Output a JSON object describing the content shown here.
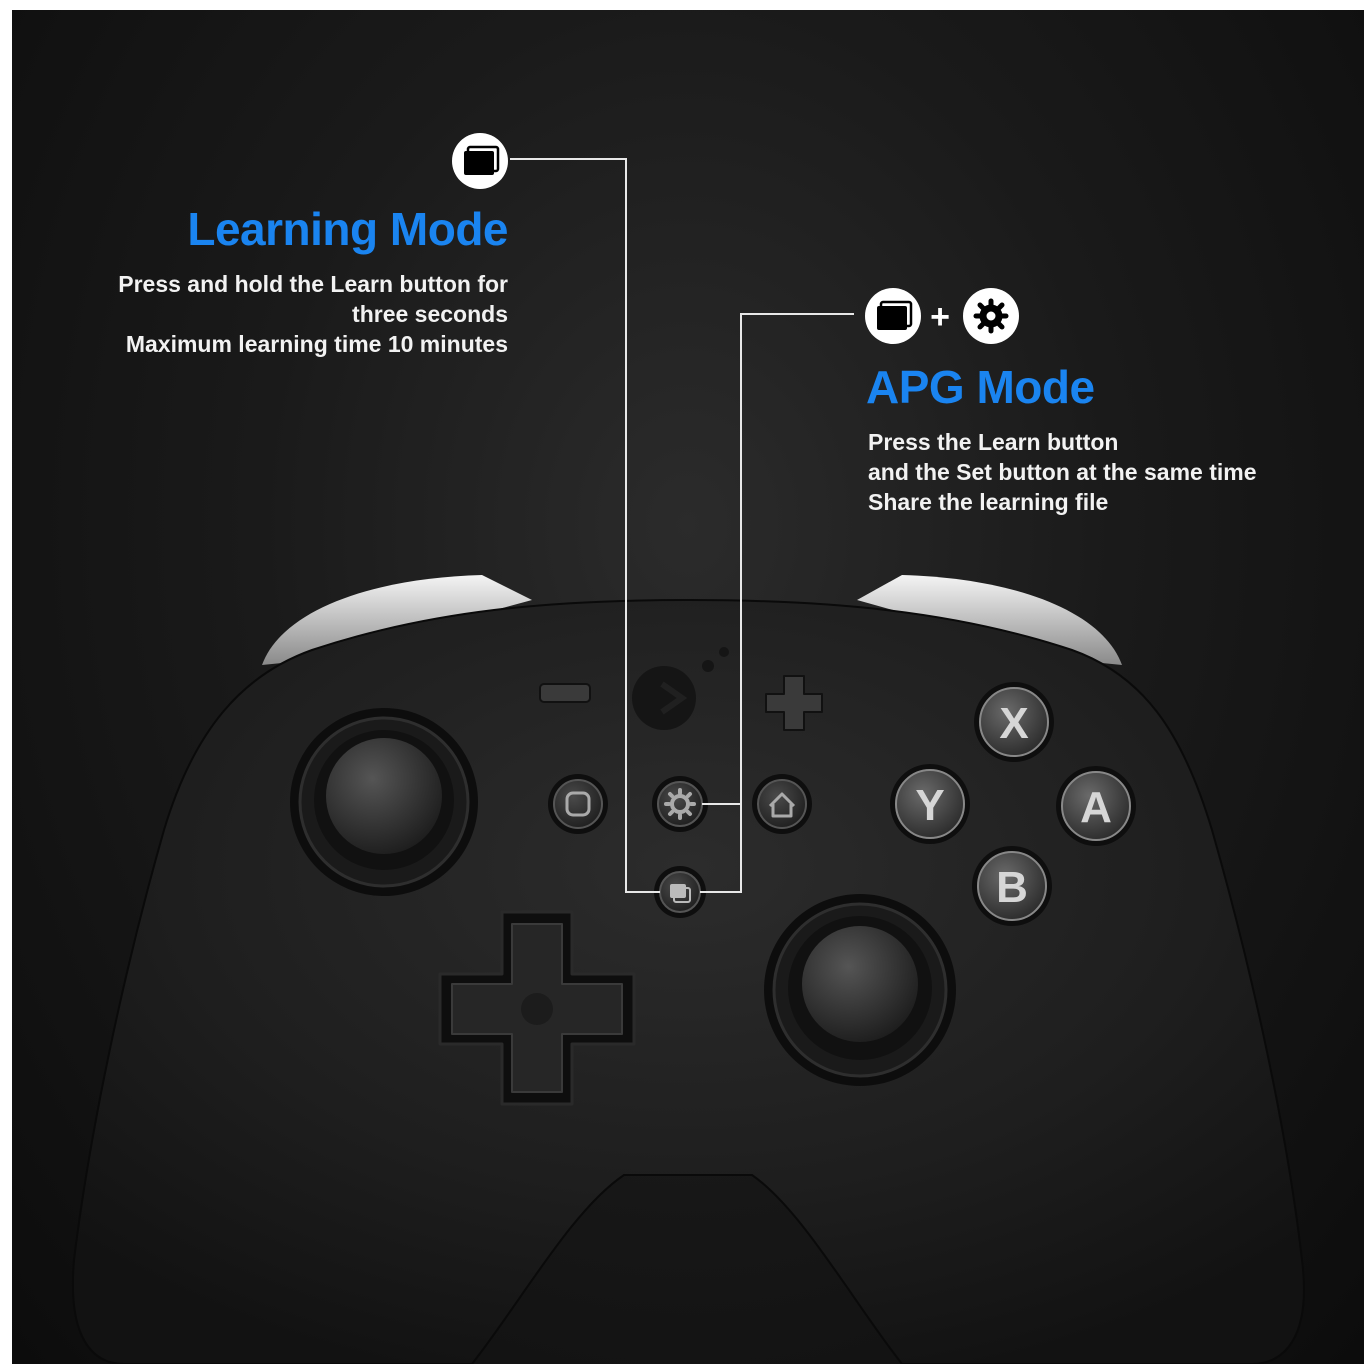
{
  "learning_mode": {
    "title": "Learning Mode",
    "lines": [
      "Press and hold the Learn button for",
      "three seconds",
      "Maximum learning time 10 minutes"
    ],
    "icon": "learn-button-icon"
  },
  "apg_mode": {
    "title": "APG Mode",
    "lines": [
      "Press the Learn button",
      "and the Set button at the same time",
      "Share the learning file"
    ],
    "icons": [
      "learn-button-icon",
      "gear-icon"
    ],
    "plus": "+"
  },
  "controller": {
    "face_buttons": {
      "x": "X",
      "y": "Y",
      "a": "A",
      "b": "B"
    }
  },
  "colors": {
    "accent": "#1a84f0",
    "text": "#f2f2f2",
    "background": "#141414",
    "body": "#222222"
  }
}
